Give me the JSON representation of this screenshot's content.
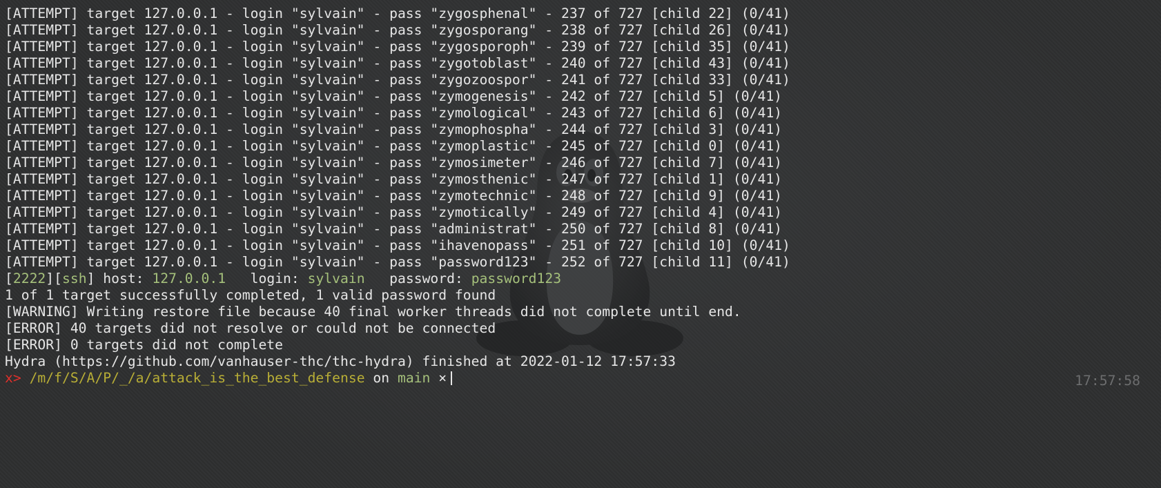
{
  "attempts": [
    "[ATTEMPT] target 127.0.0.1 - login \"sylvain\" - pass \"zygosphenal\" - 237 of 727 [child 22] (0/41)",
    "[ATTEMPT] target 127.0.0.1 - login \"sylvain\" - pass \"zygosporang\" - 238 of 727 [child 26] (0/41)",
    "[ATTEMPT] target 127.0.0.1 - login \"sylvain\" - pass \"zygosporoph\" - 239 of 727 [child 35] (0/41)",
    "[ATTEMPT] target 127.0.0.1 - login \"sylvain\" - pass \"zygotoblast\" - 240 of 727 [child 43] (0/41)",
    "[ATTEMPT] target 127.0.0.1 - login \"sylvain\" - pass \"zygozoospor\" - 241 of 727 [child 33] (0/41)",
    "[ATTEMPT] target 127.0.0.1 - login \"sylvain\" - pass \"zymogenesis\" - 242 of 727 [child 5] (0/41)",
    "[ATTEMPT] target 127.0.0.1 - login \"sylvain\" - pass \"zymological\" - 243 of 727 [child 6] (0/41)",
    "[ATTEMPT] target 127.0.0.1 - login \"sylvain\" - pass \"zymophospha\" - 244 of 727 [child 3] (0/41)",
    "[ATTEMPT] target 127.0.0.1 - login \"sylvain\" - pass \"zymoplastic\" - 245 of 727 [child 0] (0/41)",
    "[ATTEMPT] target 127.0.0.1 - login \"sylvain\" - pass \"zymosimeter\" - 246 of 727 [child 7] (0/41)",
    "[ATTEMPT] target 127.0.0.1 - login \"sylvain\" - pass \"zymosthenic\" - 247 of 727 [child 1] (0/41)",
    "[ATTEMPT] target 127.0.0.1 - login \"sylvain\" - pass \"zymotechnic\" - 248 of 727 [child 9] (0/41)",
    "[ATTEMPT] target 127.0.0.1 - login \"sylvain\" - pass \"zymotically\" - 249 of 727 [child 4] (0/41)",
    "[ATTEMPT] target 127.0.0.1 - login \"sylvain\" - pass \"administrat\" - 250 of 727 [child 8] (0/41)",
    "[ATTEMPT] target 127.0.0.1 - login \"sylvain\" - pass \"ihavenopass\" - 251 of 727 [child 10] (0/41)",
    "[ATTEMPT] target 127.0.0.1 - login \"sylvain\" - pass \"password123\" - 252 of 727 [child 11] (0/41)"
  ],
  "result": {
    "open_bracket": "[",
    "port": "2222",
    "mid_bracket": "][",
    "service": "ssh",
    "close_bracket_host": "] host: ",
    "host": "127.0.0.1",
    "login_label": "   login: ",
    "login": "sylvain",
    "password_label": "   password: ",
    "password": "password123"
  },
  "summary_lines": [
    "1 of 1 target successfully completed, 1 valid password found",
    "[WARNING] Writing restore file because 40 final worker threads did not complete until end.",
    "[ERROR] 40 targets did not resolve or could not be connected",
    "[ERROR] 0 targets did not complete",
    "Hydra (https://github.com/vanhauser-thc/thc-hydra) finished at 2022-01-12 17:57:33"
  ],
  "prompt": {
    "symbol": "x>",
    "path": "/m/f/S/A/P/_/a/attack_is_the_best_defense",
    "on_text": " on ",
    "branch": "main",
    "dirty_mark": " ×"
  },
  "clock": "17:57:58",
  "colors": {
    "background": "#2e2f30",
    "text": "#e6e6e6",
    "green": "#a5c07b",
    "red": "#e0302b",
    "olive": "#b8ae36",
    "dim": "#6c6d6e"
  }
}
